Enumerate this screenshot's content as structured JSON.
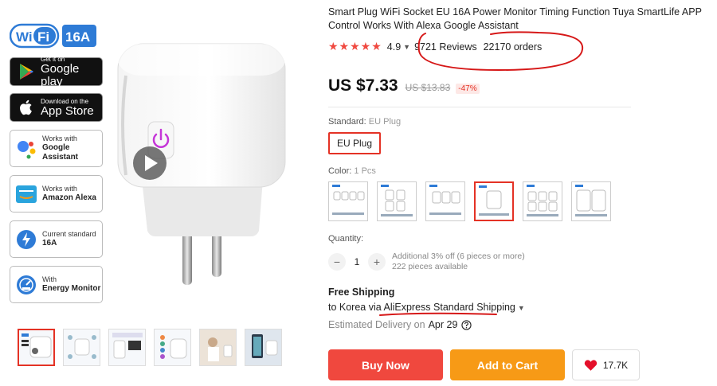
{
  "gallery": {
    "wifi_logo": {
      "left": "Wi",
      "right": "Fi",
      "rating": "16A"
    },
    "badges": {
      "google_play": {
        "small": "Get it on",
        "big": "Google play"
      },
      "app_store": {
        "small": "Download on the",
        "big": "App Store"
      }
    },
    "features": [
      {
        "line1": "Works with",
        "line2": "Google Assistant",
        "icon": "google-assistant-icon"
      },
      {
        "line1": "Works with",
        "line2": "Amazon Alexa",
        "icon": "amazon-alexa-icon"
      },
      {
        "line1": "Current standard",
        "line2": "16A",
        "icon": "current-standard-icon"
      },
      {
        "line1": "With",
        "line2": "Energy Monitor",
        "icon": "energy-monitor-icon"
      }
    ],
    "thumbnail_count": 6,
    "active_thumbnail": 1
  },
  "product": {
    "title": "Smart Plug WiFi Socket EU 16A Power Monitor Timing Function Tuya SmartLife APP Control Works With Alexa Google Assistant",
    "stars": "★★★★★",
    "rating": "4.9",
    "reviews": "9721 Reviews",
    "orders": "22170 orders",
    "price": "US $7.33",
    "old_price": "US $13.83",
    "discount": "-47%"
  },
  "options": {
    "standard_label": "Standard:",
    "standard_value": "EU Plug",
    "standard_button": "EU Plug",
    "color_label": "Color:",
    "color_value": "1 Pcs",
    "color_count": 6,
    "active_color": 4
  },
  "quantity": {
    "label": "Quantity:",
    "minus": "−",
    "value": "1",
    "plus": "+",
    "note_line1": "Additional 3% off (6 pieces or more)",
    "note_line2": "222 pieces available"
  },
  "shipping": {
    "title": "Free Shipping",
    "prefix": "to Korea via ",
    "method": "AliExpress Standard Shipping",
    "delivery_label": "Estimated Delivery on",
    "delivery_date": "Apr 29"
  },
  "actions": {
    "buy_now": "Buy Now",
    "add_to_cart": "Add to Cart",
    "wishlist_count": "17.7K"
  },
  "colors": {
    "accent": "#e43225",
    "buy": "#f0483e",
    "cart": "#f79a16",
    "star": "#f04940"
  }
}
